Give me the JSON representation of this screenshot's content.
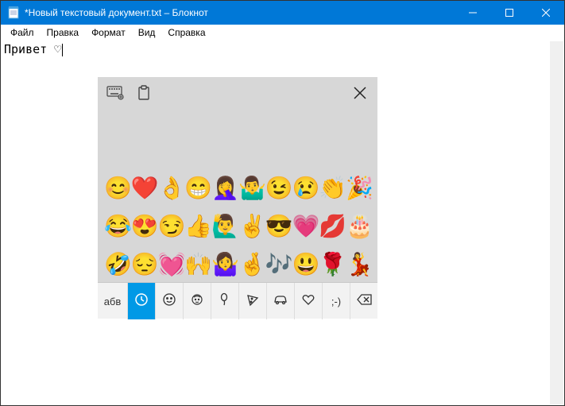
{
  "window": {
    "title": "*Новый текстовый документ.txt – Блокнот"
  },
  "menubar": [
    "Файл",
    "Правка",
    "Формат",
    "Вид",
    "Справка"
  ],
  "editor": {
    "content": "Привет ♡"
  },
  "emoji_panel": {
    "grid": [
      [
        "😊",
        "❤️",
        "👌",
        "😁",
        "🤦‍♀️",
        "🤷‍♂️",
        "😉",
        "😢",
        "👏",
        "🎉"
      ],
      [
        "😂",
        "😍",
        "😏",
        "👍",
        "🙋‍♂️",
        "✌️",
        "😎",
        "💗",
        "💋",
        "🎂"
      ],
      [
        "🤣",
        "😔",
        "💓",
        "🙌",
        "🤷‍♀️",
        "🤞",
        "🎶",
        "😃",
        "🌹",
        "💃"
      ]
    ],
    "categories": {
      "abc_label": "абв",
      "wink_label": ";-)"
    }
  }
}
